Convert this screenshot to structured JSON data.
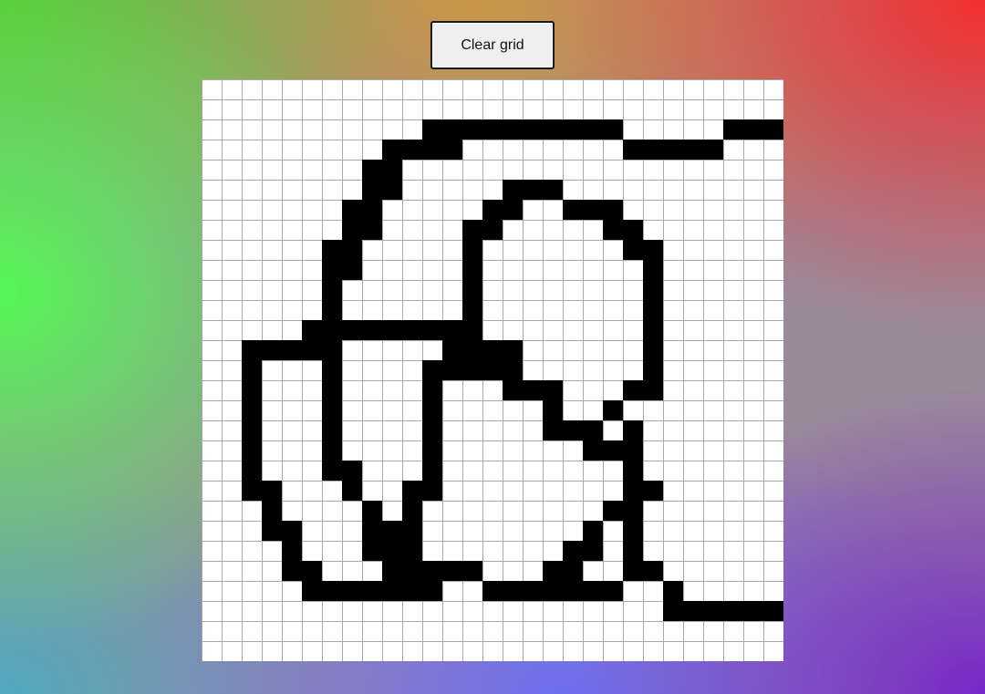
{
  "toolbar": {
    "clear_label": "Clear grid"
  },
  "grid": {
    "columns": 29,
    "rows": 29,
    "filled_color": "#000000",
    "empty_color": "#ffffff",
    "line_color": "#a8a8a8",
    "cells": [
      ".............................",
      ".............................",
      "...........##########.....###",
      ".........####........#####...",
      "........##...................",
      "........##.....###...........",
      ".......##.....##..###........",
      ".......##....##.....##.......",
      "......##.....#.......##......",
      "......##.....#........#......",
      "......#......#........#......",
      "......#......#........#......",
      ".....#########........#......",
      "..#####.....####......#......",
      "..#...#....#####......#......",
      "..#...#....#...###...##......",
      "..#...#....#.....#..#........",
      "..#...#....#.....###.#.......",
      "..#...#....#.......###.......",
      "..#...##...#.........#.......",
      "..##...#..##.........##......",
      "...#....#.#.........##.......",
      "...##...###........#.#.......",
      "....#...###.......##.#.......",
      "....##...#####...##..##......",
      ".....#######..#######..#.....",
      ".......................######",
      ".............................",
      "............................."
    ]
  }
}
